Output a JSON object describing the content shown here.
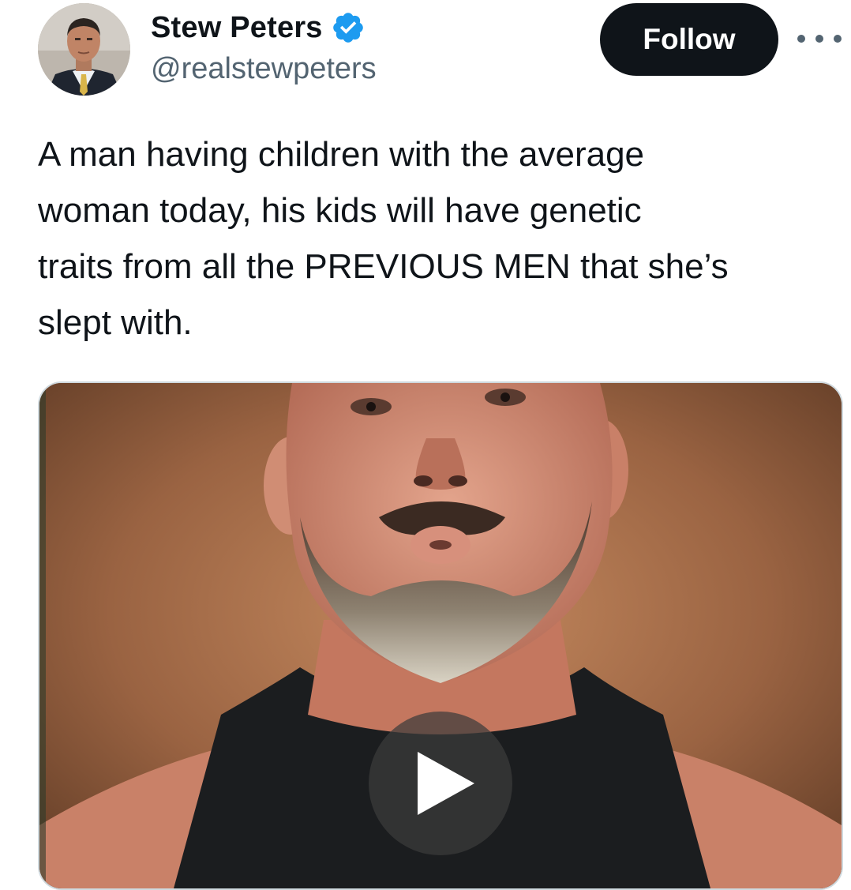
{
  "author": {
    "display_name": "Stew Peters",
    "handle": "@realstewpeters",
    "verified_icon": "verified-badge-icon",
    "verified_color": "#1d9bf0"
  },
  "actions": {
    "follow_label": "Follow",
    "more_icon": "more-horizontal-icon"
  },
  "tweet": {
    "text_lines": [
      "A man having children with the average",
      "woman today, his kids will have genetic",
      "traits from all the PREVIOUS MEN that she’s",
      "slept with."
    ]
  },
  "media": {
    "type": "video",
    "play_icon": "play-icon"
  },
  "colors": {
    "text_primary": "#0f1419",
    "text_secondary": "#536471",
    "follow_bg": "#0f1419",
    "follow_text": "#ffffff"
  }
}
